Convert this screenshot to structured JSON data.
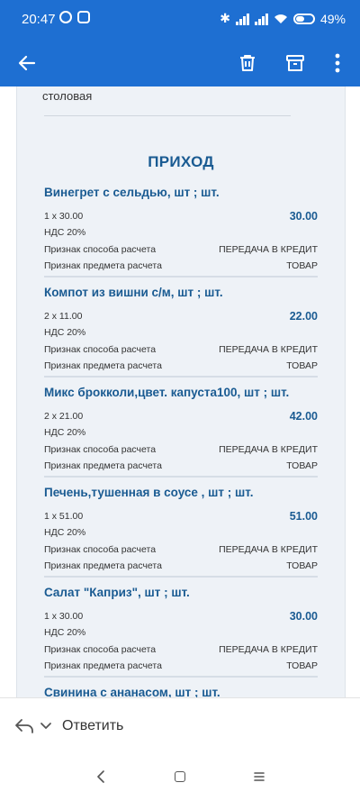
{
  "status_bar": {
    "time": "20:47",
    "battery": "49%"
  },
  "toolbar": {
    "back_icon": "arrow-left-icon",
    "delete_icon": "trash-icon",
    "archive_icon": "archive-icon",
    "more_icon": "more-vert-icon"
  },
  "receipt": {
    "vendor_fragment": "столовая",
    "section_title": "ПРИХОД",
    "items": [
      {
        "name": "Винегрет с сельдью, шт ; шт.",
        "qty_price": "1 x 30.00",
        "amount": "30.00",
        "vat": "НДС 20%",
        "payment_method_label": "Признак способа расчета",
        "payment_method_value": "ПЕРЕДАЧА В КРЕДИТ",
        "subject_label": "Признак предмета расчета",
        "subject_value": "ТОВАР"
      },
      {
        "name": "Компот из вишни с/м, шт ; шт.",
        "qty_price": "2 x 11.00",
        "amount": "22.00",
        "vat": "НДС 20%",
        "payment_method_label": "Признак способа расчета",
        "payment_method_value": "ПЕРЕДАЧА В КРЕДИТ",
        "subject_label": "Признак предмета расчета",
        "subject_value": "ТОВАР"
      },
      {
        "name": "Микс брокколи,цвет. капуста100, шт ; шт.",
        "qty_price": "2 x 21.00",
        "amount": "42.00",
        "vat": "НДС 20%",
        "payment_method_label": "Признак способа расчета",
        "payment_method_value": "ПЕРЕДАЧА В КРЕДИТ",
        "subject_label": "Признак предмета расчета",
        "subject_value": "ТОВАР"
      },
      {
        "name": "Печень,тушенная в соусе , шт ; шт.",
        "qty_price": "1 x 51.00",
        "amount": "51.00",
        "vat": "НДС 20%",
        "payment_method_label": "Признак способа расчета",
        "payment_method_value": "ПЕРЕДАЧА В КРЕДИТ",
        "subject_label": "Признак предмета расчета",
        "subject_value": "ТОВАР"
      },
      {
        "name": "Салат \"Каприз\", шт ; шт.",
        "qty_price": "1 x 30.00",
        "amount": "30.00",
        "vat": "НДС 20%",
        "payment_method_label": "Признак способа расчета",
        "payment_method_value": "ПЕРЕДАЧА В КРЕДИТ",
        "subject_label": "Признак предмета расчета",
        "subject_value": "ТОВАР"
      },
      {
        "name": "Свинина с ананасом, шт ; шт."
      }
    ]
  },
  "reply_bar": {
    "reply_label": "Ответить",
    "reply_icon": "reply-icon",
    "dropdown_icon": "chevron-down-icon"
  },
  "nav_bar": {
    "back_icon": "nav-back-icon",
    "home_icon": "nav-home-icon",
    "recents_icon": "nav-menu-icon"
  },
  "colors": {
    "header_blue": "#1e6fd2",
    "title_blue": "#1a5b92",
    "receipt_bg": "#eef2f7"
  }
}
